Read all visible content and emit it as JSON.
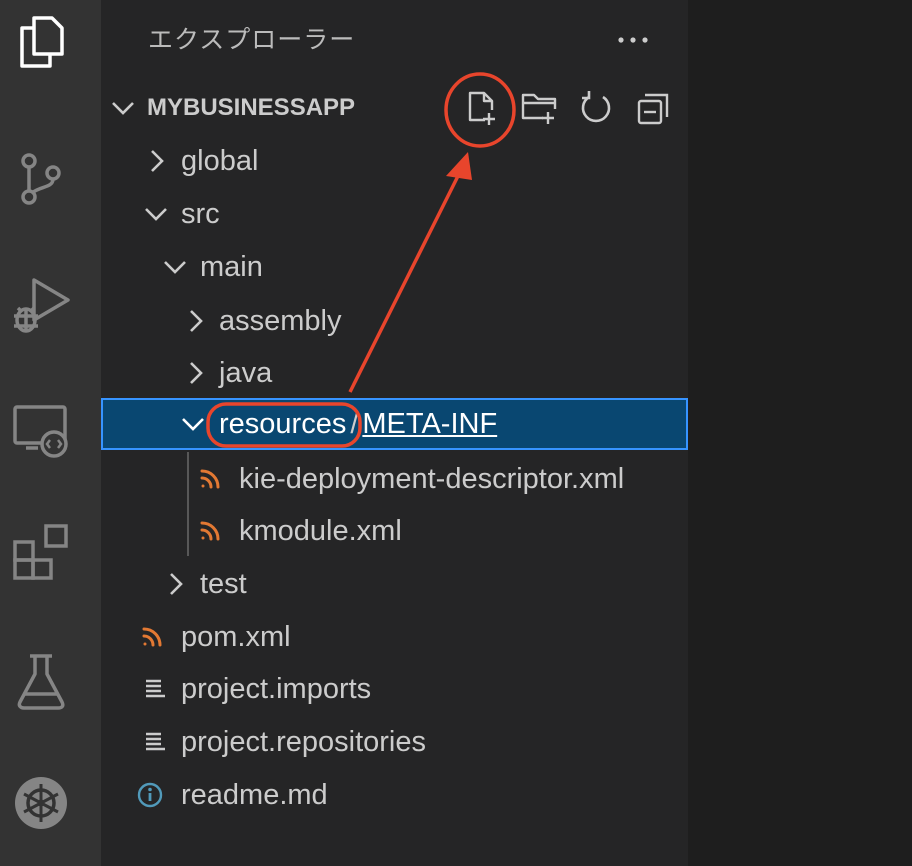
{
  "activity_bar": {
    "items": [
      {
        "icon": "files-icon",
        "active": true
      },
      {
        "icon": "source-control-icon"
      },
      {
        "icon": "run-debug-icon"
      },
      {
        "icon": "remote-explorer-icon"
      },
      {
        "icon": "extensions-icon"
      },
      {
        "icon": "testing-icon"
      },
      {
        "icon": "kubernetes-icon"
      }
    ]
  },
  "sidebar": {
    "title": "エクスプローラー",
    "more_icon": "ellipsis-icon",
    "section": {
      "title": "MYBUSINESSAPP",
      "actions": [
        {
          "icon": "new-file-icon",
          "highlighted": true
        },
        {
          "icon": "new-folder-icon"
        },
        {
          "icon": "refresh-icon"
        },
        {
          "icon": "collapse-all-icon"
        }
      ]
    },
    "tree": [
      {
        "label": "global",
        "type": "folder",
        "expanded": false
      },
      {
        "label": "src",
        "type": "folder",
        "expanded": true
      },
      {
        "label": "main",
        "type": "folder",
        "expanded": true
      },
      {
        "label": "assembly",
        "type": "folder",
        "expanded": false
      },
      {
        "label": "java",
        "type": "folder",
        "expanded": false
      },
      {
        "label": "resources",
        "compact_separator": "/",
        "compact_child": "META-INF",
        "type": "folder",
        "expanded": true,
        "selected": true
      },
      {
        "label": "kie-deployment-descriptor.xml",
        "type": "file",
        "icon": "rss-icon"
      },
      {
        "label": "kmodule.xml",
        "type": "file",
        "icon": "rss-icon"
      },
      {
        "label": "test",
        "type": "folder",
        "expanded": false
      },
      {
        "label": "pom.xml",
        "type": "file",
        "icon": "rss-icon"
      },
      {
        "label": "project.imports",
        "type": "file",
        "icon": "lines-icon"
      },
      {
        "label": "project.repositories",
        "type": "file",
        "icon": "lines-icon"
      },
      {
        "label": "readme.md",
        "type": "file",
        "icon": "info-icon"
      }
    ]
  },
  "colors": {
    "activity_bar": "#333333",
    "sidebar": "#252526",
    "selection": "#094771",
    "focus_border": "#3794ff",
    "annotation": "#e8452c",
    "xml_icon": "#e37933",
    "info_icon": "#519aba"
  }
}
